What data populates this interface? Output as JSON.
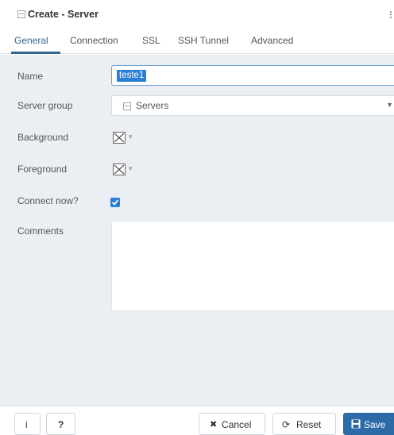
{
  "dialog": {
    "title": "Create - Server",
    "menu_glyph": "⁝"
  },
  "tabs": [
    {
      "label": "General",
      "active": true
    },
    {
      "label": "Connection",
      "active": false
    },
    {
      "label": "SSL",
      "active": false
    },
    {
      "label": "SSH Tunnel",
      "active": false
    },
    {
      "label": "Advanced",
      "active": false
    }
  ],
  "form": {
    "name_label": "Name",
    "name_value": "teste1",
    "server_group_label": "Server group",
    "server_group_value": "Servers",
    "background_label": "Background",
    "foreground_label": "Foreground",
    "connect_now_label": "Connect now?",
    "connect_now_checked": true,
    "comments_label": "Comments",
    "comments_value": ""
  },
  "footer": {
    "info_label": "i",
    "help_label": "?",
    "cancel_label": "Cancel",
    "reset_label": "Reset",
    "save_label": "Save"
  },
  "colors": {
    "accent": "#326690",
    "primary_button": "#2c6aa8",
    "selection": "#2a7fd4",
    "panel_bg": "#ebeef3"
  },
  "icons": {
    "title": "server-icon",
    "server_group": "server-group-icon",
    "cancel": "close-icon",
    "reset": "reset-icon",
    "save": "save-icon"
  }
}
